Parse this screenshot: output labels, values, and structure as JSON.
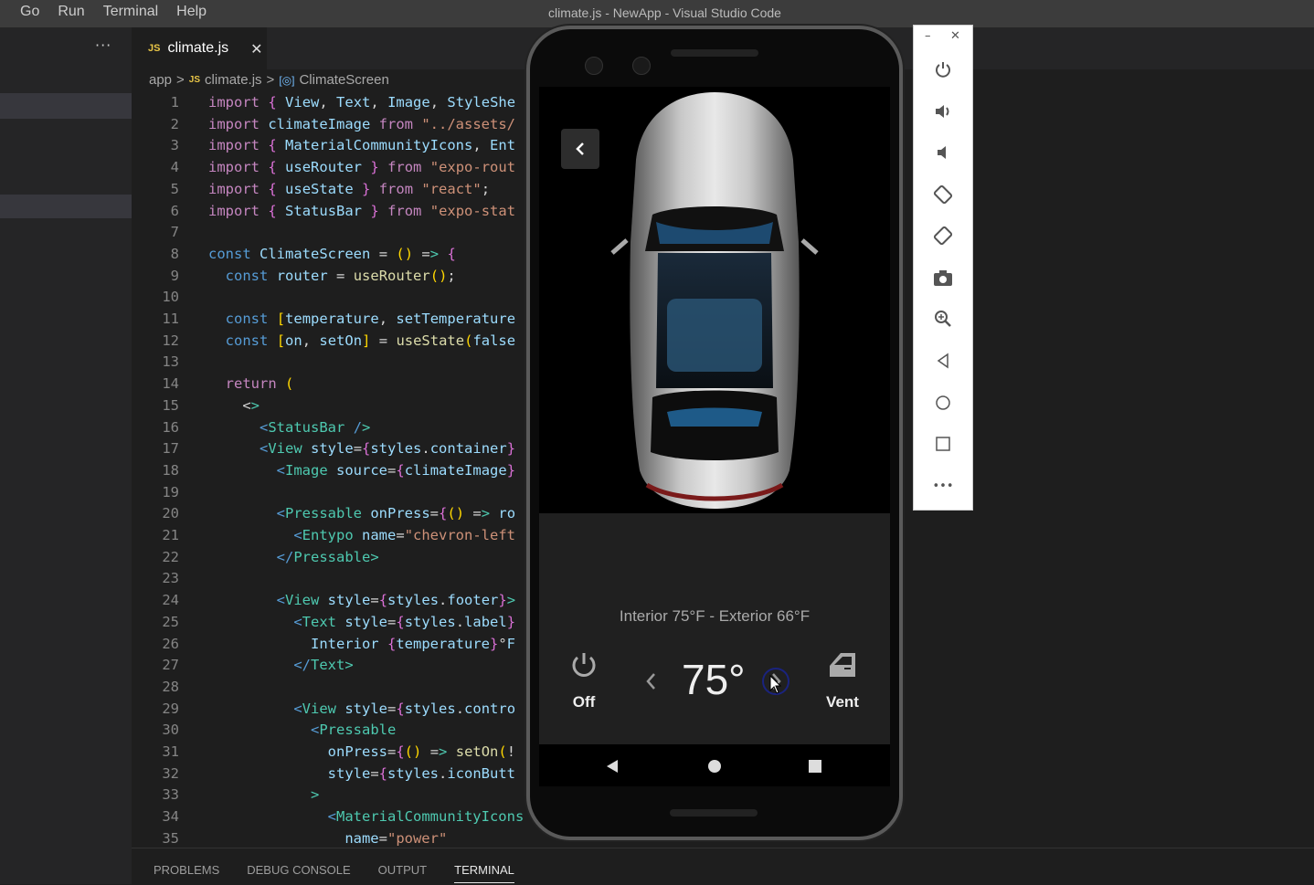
{
  "window": {
    "title": "climate.js - NewApp - Visual Studio Code"
  },
  "menu": [
    "Go",
    "Run",
    "Terminal",
    "Help"
  ],
  "sidebar": {
    "more_label": "···"
  },
  "tab": {
    "icon_label": "JS",
    "name": "climate.js",
    "close_label": "✕"
  },
  "breadcrumb": {
    "folder": "app",
    "sep1": ">",
    "file_icon": "JS",
    "file": "climate.js",
    "sep2": ">",
    "symbol_icon": "[◎]",
    "symbol": "ClimateScreen"
  },
  "editor": {
    "lines": [
      {
        "n": "1",
        "t": "import { View, Text, Image, StyleShe"
      },
      {
        "n": "2",
        "t": "import climateImage from \"../assets/"
      },
      {
        "n": "3",
        "t": "import { MaterialCommunityIcons, Ent"
      },
      {
        "n": "4",
        "t": "import { useRouter } from \"expo-rout"
      },
      {
        "n": "5",
        "t": "import { useState } from \"react\";"
      },
      {
        "n": "6",
        "t": "import { StatusBar } from \"expo-stat"
      },
      {
        "n": "7",
        "t": ""
      },
      {
        "n": "8",
        "t": "const ClimateScreen = () => {"
      },
      {
        "n": "9",
        "t": "  const router = useRouter();"
      },
      {
        "n": "10",
        "t": ""
      },
      {
        "n": "11",
        "t": "  const [temperature, setTemperature"
      },
      {
        "n": "12",
        "t": "  const [on, setOn] = useState(false"
      },
      {
        "n": "13",
        "t": ""
      },
      {
        "n": "14",
        "t": "  return ("
      },
      {
        "n": "15",
        "t": "    <>"
      },
      {
        "n": "16",
        "t": "      <StatusBar />"
      },
      {
        "n": "17",
        "t": "      <View style={styles.container}"
      },
      {
        "n": "18",
        "t": "        <Image source={climateImage}"
      },
      {
        "n": "19",
        "t": ""
      },
      {
        "n": "20",
        "t": "        <Pressable onPress={() => ro"
      },
      {
        "n": "21",
        "t": "          <Entypo name=\"chevron-left"
      },
      {
        "n": "22",
        "t": "        </Pressable>"
      },
      {
        "n": "23",
        "t": ""
      },
      {
        "n": "24",
        "t": "        <View style={styles.footer}>"
      },
      {
        "n": "25",
        "t": "          <Text style={styles.label}"
      },
      {
        "n": "26",
        "t": "            Interior {temperature}°F"
      },
      {
        "n": "27",
        "t": "          </Text>"
      },
      {
        "n": "28",
        "t": ""
      },
      {
        "n": "29",
        "t": "          <View style={styles.contro"
      },
      {
        "n": "30",
        "t": "            <Pressable"
      },
      {
        "n": "31",
        "t": "              onPress={() => setOn(!"
      },
      {
        "n": "32",
        "t": "              style={styles.iconButt"
      },
      {
        "n": "33",
        "t": "            >"
      },
      {
        "n": "34",
        "t": "              <MaterialCommunityIcons"
      },
      {
        "n": "35",
        "t": "                name=\"power\""
      }
    ]
  },
  "panel": {
    "tabs": [
      "PROBLEMS",
      "DEBUG CONSOLE",
      "OUTPUT",
      "TERMINAL"
    ],
    "active": "TERMINAL"
  },
  "app": {
    "label": "Interior 75°F - Exterior 66°F",
    "power_label": "Off",
    "temperature": "75°",
    "vent_label": "Vent"
  },
  "emulator_toolbar": {
    "minimize": "–",
    "close": "✕",
    "buttons": [
      "power-icon",
      "volume-up-icon",
      "volume-down-icon",
      "rotate-left-icon",
      "rotate-right-icon",
      "camera-icon",
      "zoom-icon",
      "back-icon",
      "home-icon",
      "overview-icon",
      "more-icon"
    ],
    "more_label": "•••"
  },
  "colors": {
    "editor_bg": "#1e1e1e",
    "sidebar_bg": "#252526",
    "titlebar_bg": "#3c3c3c",
    "phone_bg": "#202020"
  }
}
